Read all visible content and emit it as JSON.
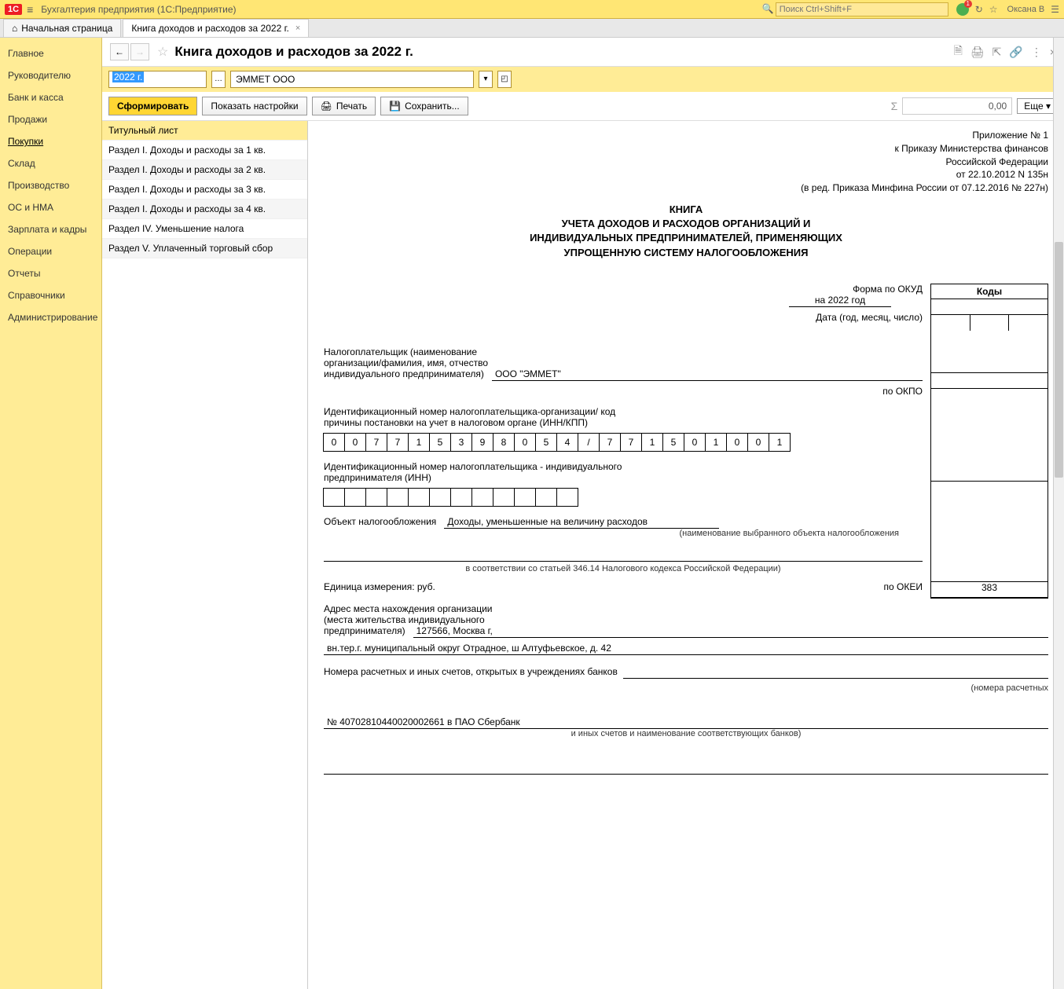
{
  "app": {
    "title": "Бухгалтерия предприятия  (1С:Предприятие)",
    "search_placeholder": "Поиск Ctrl+Shift+F",
    "user": "Оксана В"
  },
  "tabs": {
    "home": "Начальная страница",
    "active": "Книга доходов и расходов за 2022 г."
  },
  "sidebar": {
    "items": [
      "Главное",
      "Руководителю",
      "Банк и касса",
      "Продажи",
      "Покупки",
      "Склад",
      "Производство",
      "ОС и НМА",
      "Зарплата и кадры",
      "Операции",
      "Отчеты",
      "Справочники",
      "Администрирование"
    ],
    "active": "Покупки"
  },
  "page": {
    "title": "Книга доходов и расходов за 2022 г."
  },
  "filter": {
    "year": "2022 г.",
    "org": "ЭММЕТ ООО"
  },
  "actions": {
    "form": "Сформировать",
    "settings": "Показать настройки",
    "print": "Печать",
    "save": "Сохранить...",
    "sum": "0,00",
    "more": "Еще"
  },
  "sections": [
    "Титульный лист",
    "Раздел I. Доходы и расходы за 1 кв.",
    "Раздел I. Доходы и расходы за 2 кв.",
    "Раздел I. Доходы и расходы за 3 кв.",
    "Раздел I. Доходы и расходы за 4 кв.",
    "Раздел IV. Уменьшение налога",
    "Раздел V. Уплаченный торговый сбор"
  ],
  "doc": {
    "meta": [
      "Приложение № 1",
      "к Приказу Министерства финансов",
      "Российской Федерации",
      "от 22.10.2012 N 135н",
      "(в ред. Приказа Минфина России от 07.12.2016 № 227н)"
    ],
    "title1": "КНИГА",
    "title2": "УЧЕТА ДОХОДОВ И РАСХОДОВ ОРГАНИЗАЦИЙ И",
    "title3": "ИНДИВИДУАЛЬНЫХ ПРЕДПРИНИМАТЕЛЕЙ, ПРИМЕНЯЮЩИХ",
    "title4": "УПРОЩЕННУЮ СИСТЕМУ НАЛОГООБЛОЖЕНИЯ",
    "codes_header": "Коды",
    "form_okud": "Форма по ОКУД",
    "date_label": "Дата (год, месяц, число)",
    "period": "на 2022 год",
    "taxpayer_label1": "Налогоплательщик (наименование",
    "taxpayer_label2": "организации/фамилия, имя, отчество",
    "taxpayer_label3": "индивидуального предпринимателя)",
    "taxpayer_value": "ООО \"ЭММЕТ\"",
    "okpo": "по ОКПО",
    "inn_label1": "Идентификационный номер налогоплательщика-организации/ код",
    "inn_label2": "причины постановки на учет в налоговом органе (ИНН/КПП)",
    "inn_cells": [
      "0",
      "0",
      "7",
      "7",
      "1",
      "5",
      "3",
      "9",
      "8",
      "0",
      "5",
      "4",
      "/",
      "7",
      "7",
      "1",
      "5",
      "0",
      "1",
      "0",
      "0",
      "1"
    ],
    "inn_ip_label1": "Идентификационный номер налогоплательщика - индивидуального",
    "inn_ip_label2": "предпринимателя (ИНН)",
    "inn_ip_cells_count": 12,
    "object_label": "Объект налогообложения",
    "object_value": "Доходы, уменьшенные на величину расходов",
    "object_note": "(наименование выбранного объекта налогообложения",
    "object_note2": "в соответствии со статьей 346.14 Налогового кодекса Российской Федерации)",
    "unit_label": "Единица измерения:   руб.",
    "okei_label": "по ОКЕИ",
    "okei_value": "383",
    "addr_label1": "Адрес места нахождения организации",
    "addr_label2": "(места жительства индивидуального",
    "addr_label3": "предпринимателя)",
    "addr_value1": "127566, Москва г,",
    "addr_value2": "вн.тер.г. муниципальный округ Отрадное, ш Алтуфьевское, д. 42",
    "accounts_label": "Номера расчетных и иных счетов, открытых в учреждениях банков",
    "accounts_note": "(номера расчетных",
    "account_value": "№ 40702810440020002661 в ПАО Сбербанк",
    "accounts_note2": "и иных счетов и наименование соответствующих банков)"
  }
}
